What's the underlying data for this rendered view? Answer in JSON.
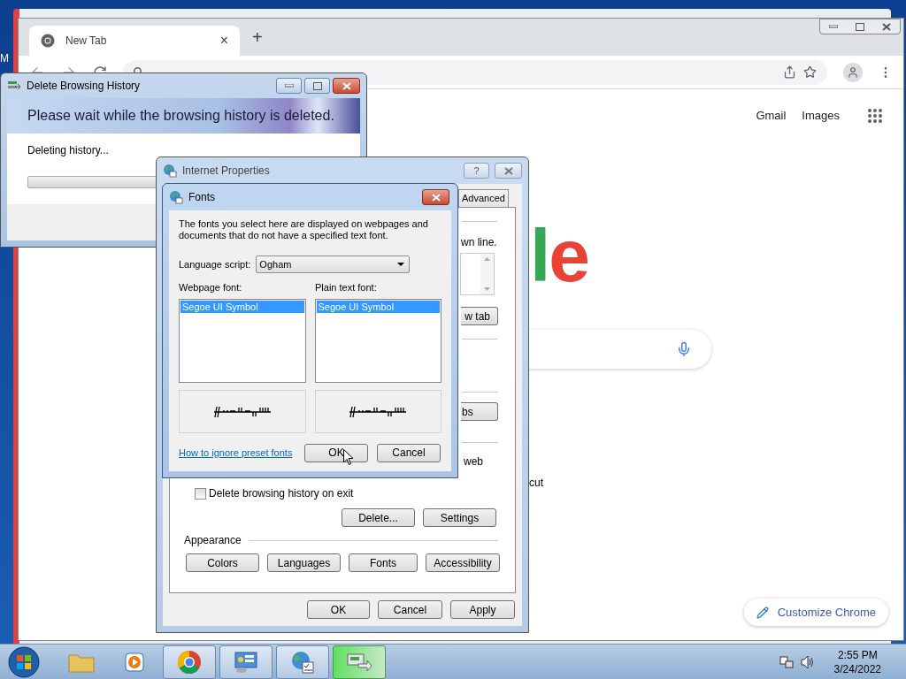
{
  "desktop": {
    "icon_label": "M"
  },
  "browser": {
    "tabs": [
      {
        "title": "New Tab",
        "close": "×",
        "selected": true
      }
    ],
    "new_tab": "+",
    "links": [
      "Gmail",
      "Images"
    ],
    "logo": [
      {
        "letter": "l",
        "color": "#34a853"
      },
      {
        "letter": "e",
        "color": "#ea4335"
      }
    ],
    "customize_button": "Customize Chrome"
  },
  "delete_history_dialog": {
    "title": "Delete Browsing History",
    "heading": "Please wait while the browsing history is deleted.",
    "status": "Deleting history...",
    "progress": {
      "level": 0
    }
  },
  "internet_properties": {
    "title": "Internet Properties",
    "help": "?",
    "tabs": [
      {
        "label": "Advanced",
        "selected": false
      }
    ],
    "fragment_1": "wn line.",
    "fragment_button_1": "w tab",
    "fragment_button_2": "bs",
    "fragment_2": "web",
    "overflow_text": "cut",
    "checkbox": {
      "label": "Delete browsing history on exit",
      "checked": false
    },
    "history_buttons": [
      "Delete...",
      "Settings"
    ],
    "appearance_label": "Appearance",
    "appearance_buttons": [
      "Colors",
      "Languages",
      "Fonts",
      "Accessibility"
    ],
    "footer_buttons": [
      "OK",
      "Cancel",
      "Apply"
    ]
  },
  "fonts_dialog": {
    "title": "Fonts",
    "description": "The fonts you select here are displayed on webpages and documents that do not have a specified text font.",
    "language_label": "Language script:",
    "language_value": "Ogham",
    "webpage_label": "Webpage font:",
    "webpage_fonts": [
      {
        "label": "Segoe UI Symbol",
        "selected": true
      }
    ],
    "plain_label": "Plain text font:",
    "plain_fonts": [
      {
        "label": "Segoe UI Symbol",
        "selected": true
      }
    ],
    "link": "How to ignore preset fonts",
    "buttons": [
      "OK",
      "Cancel"
    ]
  },
  "taskbar": {
    "time": "2:55 PM",
    "date": "3/24/2022"
  }
}
